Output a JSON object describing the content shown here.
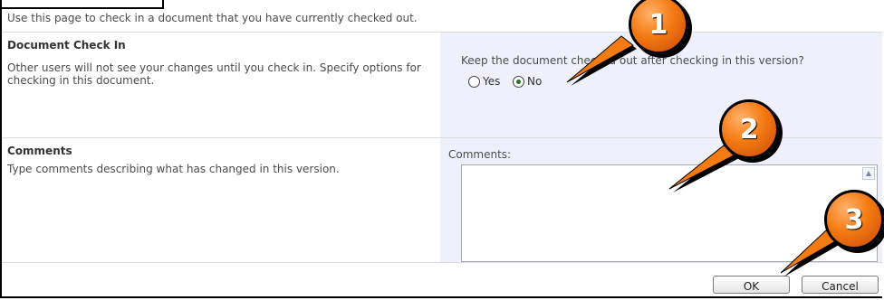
{
  "intro": "Use this page to check in a document that you have currently checked out.",
  "check_in_section": {
    "title": "Document Check In",
    "description": "Other users will not see your changes until you check in. Specify options for checking in this document.",
    "question": "Keep the document checked out after checking in this version?",
    "options": [
      {
        "label": "Yes",
        "selected": false
      },
      {
        "label": "No",
        "selected": true
      }
    ]
  },
  "comments_section": {
    "title": "Comments",
    "description": "Type comments describing what has changed in this version.",
    "field_label": "Comments:",
    "field_value": ""
  },
  "buttons": {
    "ok": "OK",
    "cancel": "Cancel"
  },
  "callouts": [
    "1",
    "2",
    "3"
  ],
  "colors": {
    "callout": "#f47a12",
    "shade": "#eef1fb"
  }
}
